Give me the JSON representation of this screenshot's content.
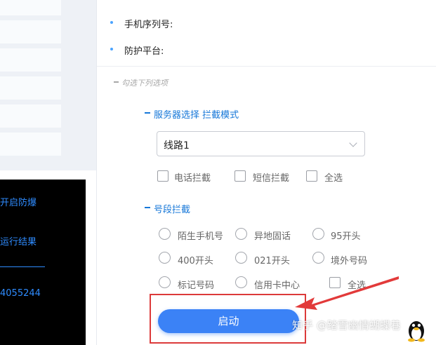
{
  "device_info": {
    "serial_label": "手机序列号:",
    "platform_label": "防护平台:"
  },
  "options_hint": "勾选下列选项",
  "server_section": {
    "title": "服务器选择 拦截模式",
    "route_value": "线路1",
    "checkboxes": [
      {
        "label": "电话拦截",
        "checked": false
      },
      {
        "label": "短信拦截",
        "checked": false
      },
      {
        "label": "全选",
        "checked": false
      }
    ]
  },
  "number_section": {
    "title": "号段拦截",
    "rows": [
      [
        "陌生手机号",
        "异地固话",
        "95开头"
      ],
      [
        "400开头",
        "021开头",
        "境外号码"
      ],
      [
        "标记号码",
        "信用卡中心"
      ]
    ],
    "select_all": "全选"
  },
  "start_button": "启动",
  "console": {
    "line1": "开启防爆",
    "line2": "运行结果",
    "line3": "4055244",
    "text_color": "#2f8cff"
  },
  "watermark": "知乎 @踏雪幽情蝴蝶巷",
  "colors": {
    "accent": "#3b82f6",
    "section_title": "#1677d8",
    "highlight": "#dc3a3a"
  }
}
